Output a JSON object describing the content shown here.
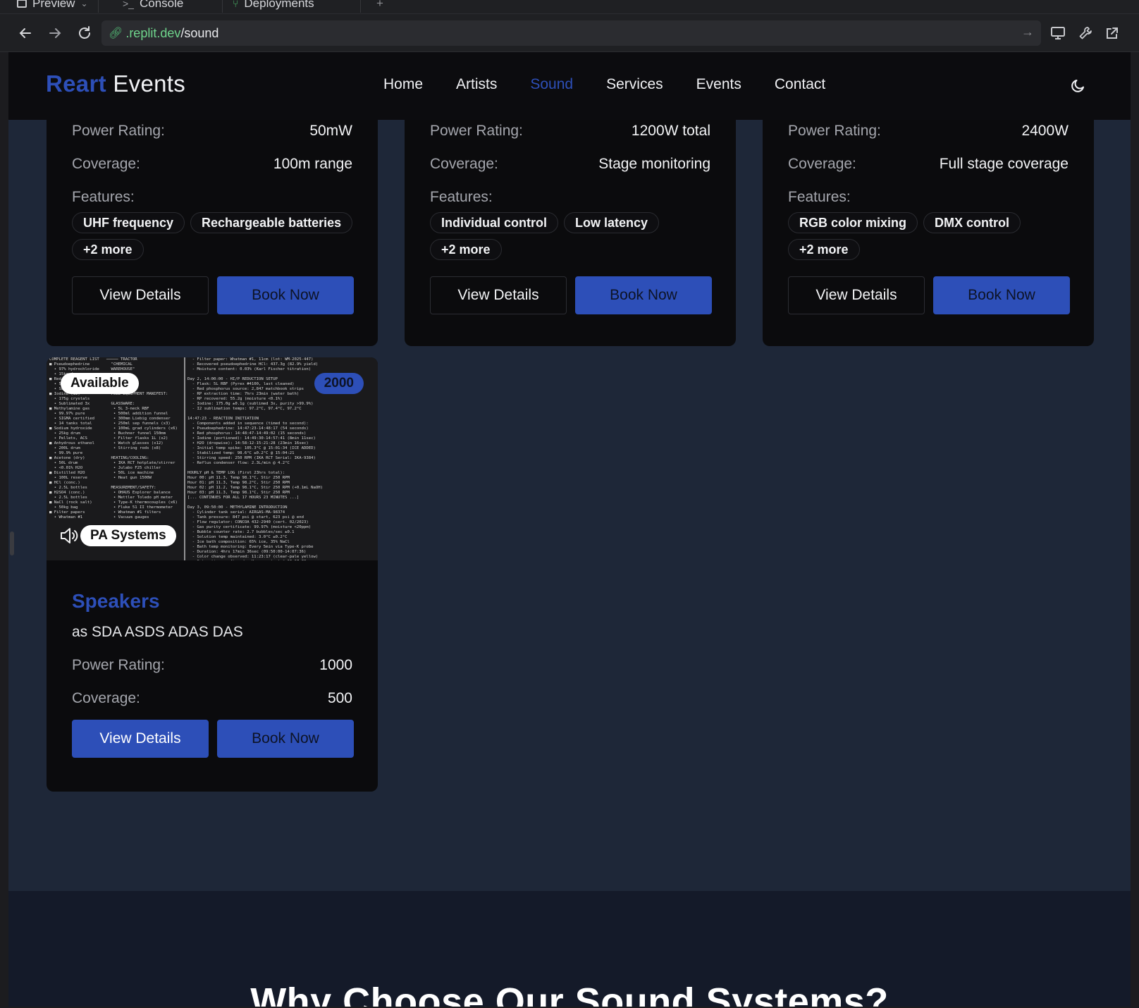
{
  "browser": {
    "tabs": [
      {
        "label": "Preview"
      },
      {
        "label": "Console"
      },
      {
        "label": "Deployments"
      }
    ],
    "new_tab": "+",
    "url_host": ".replit.dev",
    "url_path": "/sound"
  },
  "header": {
    "brand_primary": "Reart",
    "brand_secondary": "Events",
    "nav": [
      "Home",
      "Artists",
      "Sound",
      "Services",
      "Events",
      "Contact"
    ],
    "active_nav": "Sound"
  },
  "cards_top": [
    {
      "power_label": "Power Rating:",
      "power_value": "50mW",
      "coverage_label": "Coverage:",
      "coverage_value": "100m range",
      "features_label": "Features:",
      "features": [
        "UHF frequency",
        "Rechargeable batteries",
        "+2 more"
      ],
      "details_label": "View Details",
      "book_label": "Book Now"
    },
    {
      "power_label": "Power Rating:",
      "power_value": "1200W total",
      "coverage_label": "Coverage:",
      "coverage_value": "Stage monitoring",
      "features_label": "Features:",
      "features": [
        "Individual control",
        "Low latency",
        "+2 more"
      ],
      "details_label": "View Details",
      "book_label": "Book Now"
    },
    {
      "power_label": "Power Rating:",
      "power_value": "2400W",
      "coverage_label": "Coverage:",
      "coverage_value": "Full stage coverage",
      "features_label": "Features:",
      "features": [
        "RGB color mixing",
        "DMX control",
        "+2 more"
      ],
      "details_label": "View Details",
      "book_label": "Book Now"
    }
  ],
  "speaker_card": {
    "availability": "Available",
    "price": "2000",
    "category": "PA Systems",
    "title": "Speakers",
    "description": "as SDA ASDS ADAS DAS",
    "power_label": "Power Rating:",
    "power_value": "1000",
    "coverage_label": "Coverage:",
    "coverage_value": "500",
    "details_label": "View Details",
    "book_label": "Book Now"
  },
  "why_section": {
    "title": "Why Choose Our Sound Systems?"
  },
  "colors": {
    "accent": "#2d4fb8",
    "page_bg": "#1e2738",
    "card_bg": "#0b0b0d",
    "header_bg": "#0c0c0f"
  }
}
